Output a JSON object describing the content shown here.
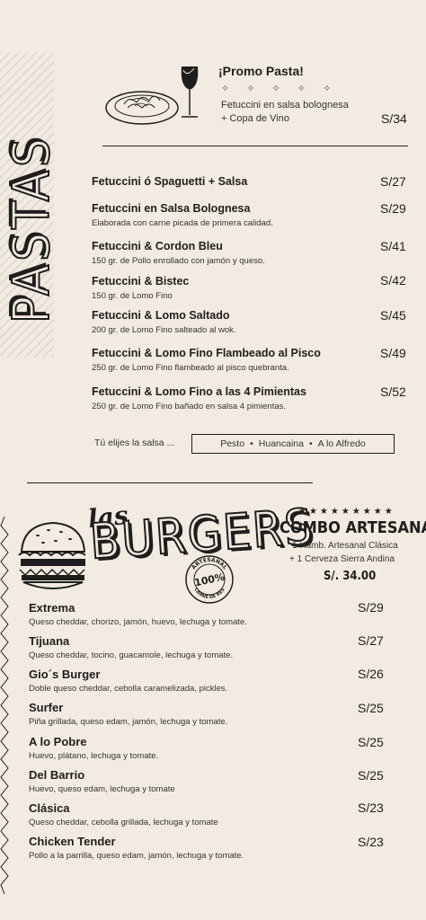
{
  "pastas": {
    "section_title": "PASTAS",
    "promo": {
      "title": "¡Promo Pasta!",
      "stars": "✧ ✧ ✧ ✧ ✧",
      "desc_line1": "Fetuccini en salsa bolognesa",
      "desc_line2": "+ Copa de Vino",
      "price": "S/34"
    },
    "items": [
      {
        "name": "Fetuccini ó Spaguetti + Salsa",
        "desc": "",
        "price": "S/27"
      },
      {
        "name": "Fetuccini en Salsa Bolognesa",
        "desc": "Elaborada con carne picada de primera calidad.",
        "price": "S/29"
      },
      {
        "name": "Fetuccini & Cordon Bleu",
        "desc": "150 gr. de Pollo enrollado con jamón y queso.",
        "price": "S/41"
      },
      {
        "name": "Fetuccini & Bistec",
        "desc": "150 gr. de Lomo Fino",
        "price": "S/42"
      },
      {
        "name": "Fetuccini & Lomo Saltado",
        "desc": "200 gr. de Lomo Fino salteado al wok.",
        "price": "S/45"
      },
      {
        "name": "Fetuccini & Lomo Fino Flambeado al Pisco",
        "desc": "250 gr. de Lomo Fino flambeado al pisco quebranta.",
        "price": "S/49"
      },
      {
        "name": "Fetuccini & Lomo Fino a las 4 Pimientas",
        "desc": "250 gr. de Lomo Fino bañado en salsa 4 pimientas.",
        "price": "S/52"
      }
    ],
    "sauce_label": "Tú elijes la salsa ...",
    "sauces": [
      "Pesto",
      "Huancaina",
      "A lo Alfredo"
    ],
    "sauce_sep": "•"
  },
  "burgers": {
    "title_small": "las",
    "title_big": "BURGERS",
    "badge": {
      "top": "ARTESANAL",
      "center": "100%",
      "bottom": "CARNE DE RES"
    },
    "combo": {
      "stars": "★★★★★★★★★",
      "title": "COMBO ARTESANAL",
      "line1": "1 Hamb. Artesanal Clásica",
      "line2": "+ 1 Cerveza Sierra Andina",
      "price": "S/. 34.00"
    },
    "items": [
      {
        "name": "Extrema",
        "desc": "Queso cheddar, chorizo, jamón, huevo, lechuga y tomate.",
        "price": "S/29"
      },
      {
        "name": "Tijuana",
        "desc": "Queso cheddar, tocino, guacamole, lechuga y tomate.",
        "price": "S/27"
      },
      {
        "name": "Gio´s  Burger",
        "desc": "Doble queso cheddar, cebolla caramelizada, pickles.",
        "price": "S/26"
      },
      {
        "name": "Surfer",
        "desc": "Piña grillada, queso edam, jamón, lechuga y tomate.",
        "price": "S/25"
      },
      {
        "name": "A lo Pobre",
        "desc": "Huevo, plátano, lechuga y tomate.",
        "price": "S/25"
      },
      {
        "name": "Del Barrio",
        "desc": "Huevo, queso edam, lechuga y tomate",
        "price": "S/25"
      },
      {
        "name": "Clásica",
        "desc": "Queso cheddar, cebolla grillada, lechuga y tomate",
        "price": "S/23"
      },
      {
        "name": "Chicken Tender",
        "desc": "Pollo a la parrilla, queso edam, jamón, lechuga y tomate.",
        "price": "S/23"
      }
    ]
  },
  "colors": {
    "background": "#f3ebe1",
    "ink": "#1e1e1e",
    "stripe": "#e2dbd1"
  }
}
